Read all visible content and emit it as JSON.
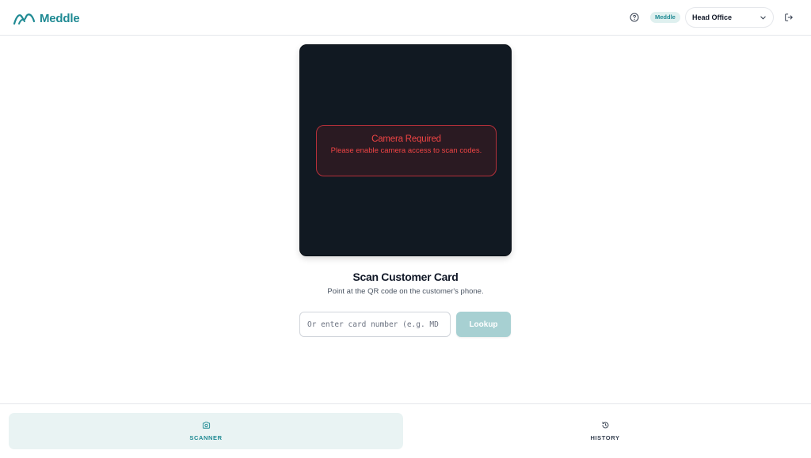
{
  "header": {
    "brand_name": "Meddle",
    "org_badge": "Meddle",
    "location": "Head Office",
    "help_icon": "help-circle-icon",
    "logout_icon": "logout-icon"
  },
  "camera": {
    "alert_title": "Camera Required",
    "alert_message": "Please enable camera access to scan codes."
  },
  "scan": {
    "title": "Scan Customer Card",
    "subtitle": "Point at the QR code on the customer's phone.",
    "input_placeholder": "Or enter card number (e.g. MD",
    "lookup_label": "Lookup"
  },
  "bottom_nav": {
    "tabs": [
      {
        "label": "SCANNER",
        "icon": "camera-icon",
        "active": true
      },
      {
        "label": "HISTORY",
        "icon": "history-icon",
        "active": false
      }
    ]
  },
  "colors": {
    "accent": "#1f8a93",
    "danger": "#ef4444",
    "camera_bg": "#111922"
  }
}
